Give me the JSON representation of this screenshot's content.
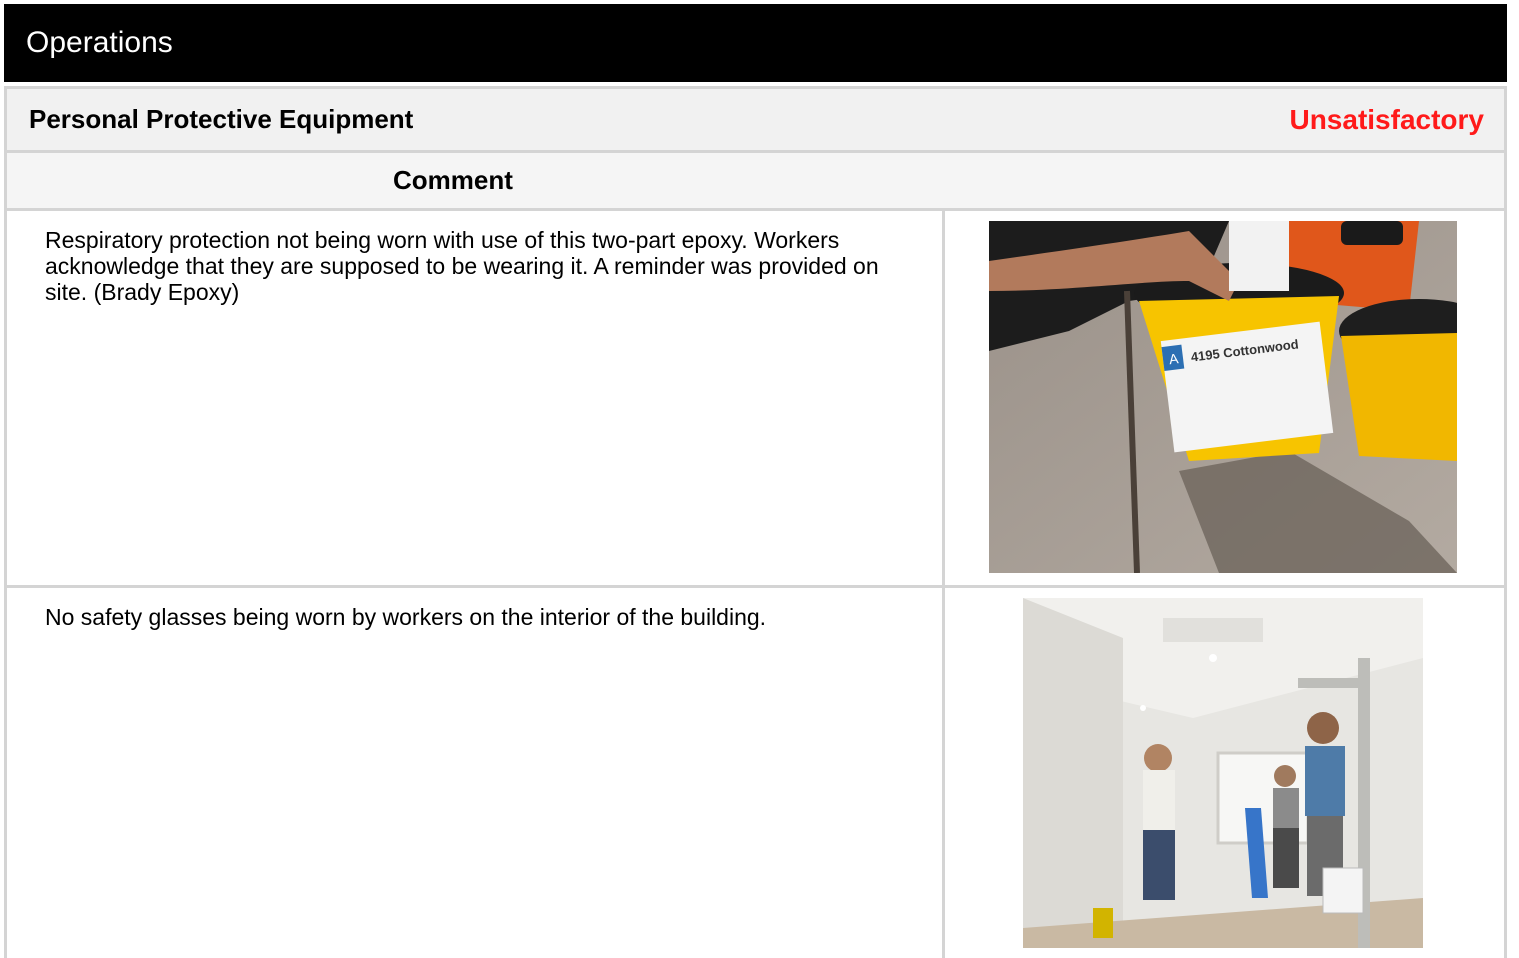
{
  "header": {
    "title": "Operations"
  },
  "section": {
    "title": "Personal Protective Equipment",
    "status": "Unsatisfactory"
  },
  "table": {
    "comment_header": "Comment"
  },
  "entries": [
    {
      "comment": "Respiratory protection not being worn with use of this two-part epoxy. Workers acknowledge that they are supposed to be wearing it. A reminder was provided on site. (Brady Epoxy)",
      "photo": {
        "bucket_letter": "A",
        "bucket_label": "4195 Cottonwood"
      }
    },
    {
      "comment": "No safety glasses being worn by workers on the interior of the building."
    }
  ]
}
